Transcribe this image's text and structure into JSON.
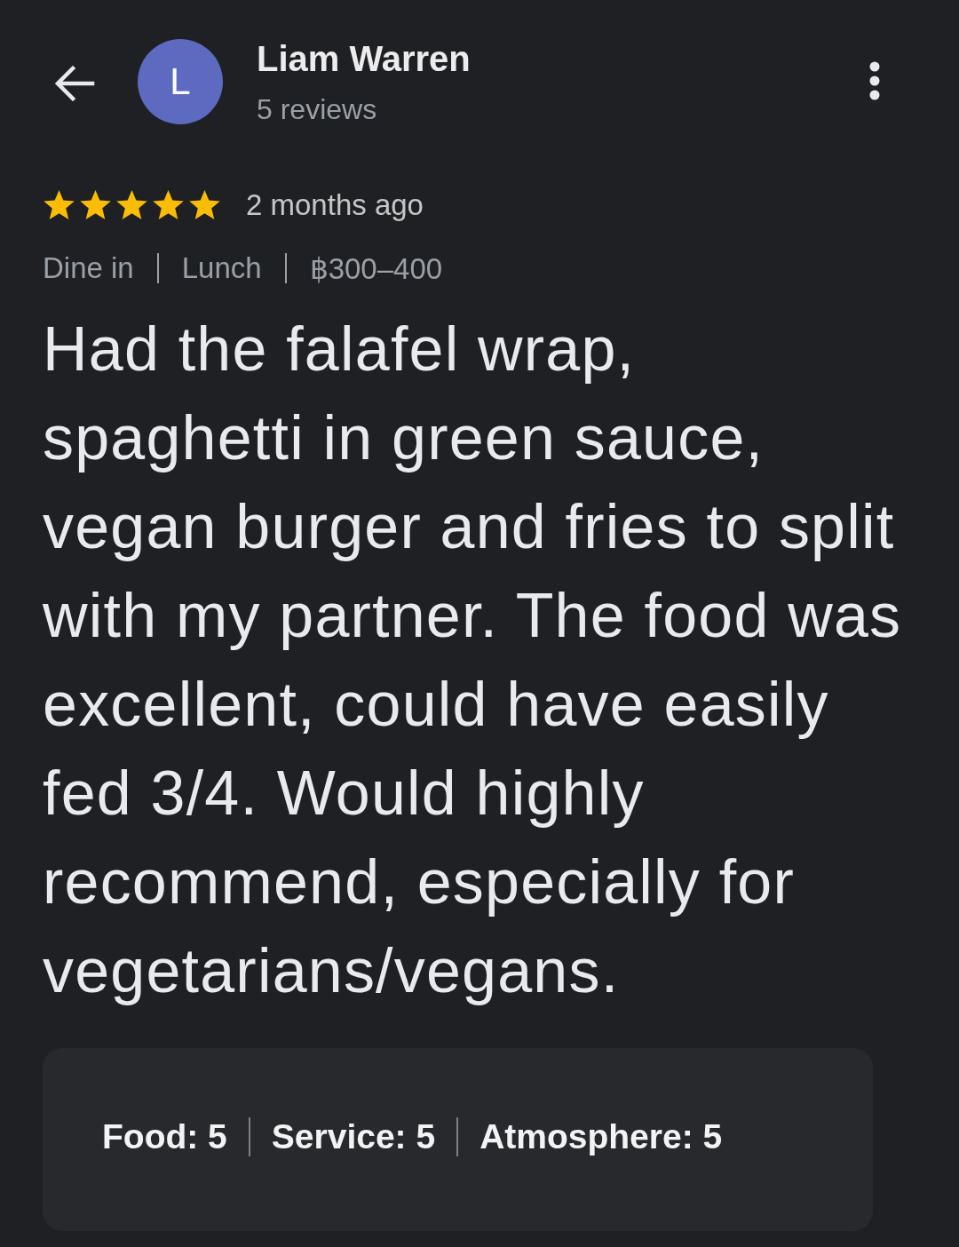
{
  "header": {
    "avatar_letter": "L",
    "name": "Liam Warren",
    "subtitle": "5 reviews"
  },
  "review": {
    "stars": 5,
    "time": "2 months ago",
    "tags": [
      "Dine in",
      "Lunch",
      "฿300–400"
    ],
    "text": "Had the falafel wrap,\nspaghetti in green sauce,\nvegan burger and fries to split\nwith my partner. The food was\nexcellent, could have easily\nfed 3/4. Would highly\nrecommend, especially for\nvegetarians/vegans.",
    "ratings": [
      "Food: 5",
      "Service: 5",
      "Atmosphere: 5"
    ]
  }
}
